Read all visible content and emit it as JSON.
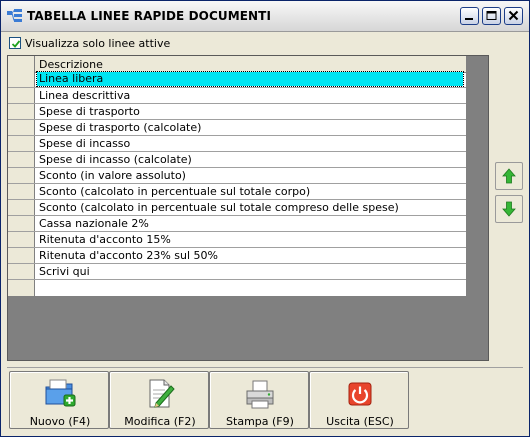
{
  "window": {
    "title": "TABELLA LINEE RAPIDE DOCUMENTI",
    "controls": [
      "minimize",
      "maximize",
      "close"
    ]
  },
  "filter": {
    "label": "Visualizza solo linee attive",
    "checked": true
  },
  "grid": {
    "column_header": "Descrizione",
    "rows": [
      "Linea libera",
      "Linea descrittiva",
      "Spese di trasporto",
      "Spese di trasporto (calcolate)",
      "Spese di incasso",
      "Spese di incasso (calcolate)",
      "Sconto (in valore assoluto)",
      "Sconto (calcolato in percentuale sul totale corpo)",
      "Sconto (calcolato in percentuale sul totale compreso delle spese)",
      "Cassa nazionale 2%",
      "Ritenuta d'acconto 15%",
      "Ritenuta d'acconto 23% sul 50%",
      "Scrivi qui"
    ],
    "selected_index": 0,
    "selection_color": "#00e5f2"
  },
  "side_buttons": {
    "up_icon": "arrow-up-icon",
    "down_icon": "arrow-down-icon",
    "arrow_color": "#2ea82e"
  },
  "toolbar": {
    "new_label": "Nuovo (F4)",
    "edit_label": "Modifica (F2)",
    "print_label": "Stampa (F9)",
    "exit_label": "Uscita (ESC)"
  }
}
